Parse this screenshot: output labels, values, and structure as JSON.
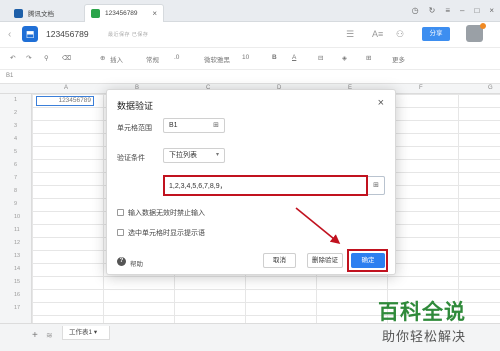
{
  "browser": {
    "tabs": [
      {
        "label": "腾讯文档"
      },
      {
        "label": "123456789"
      }
    ]
  },
  "header": {
    "doc_title": "123456789",
    "save_status": "最近保存 已保存",
    "share_label": "分享"
  },
  "toolbar": {
    "insert": "插入",
    "format_general": "常规",
    "font": "微软雅黑",
    "font_size": "10",
    "bold": "B",
    "font_color": "A",
    "more": "更多"
  },
  "formula_bar": {
    "cell_ref": "B1"
  },
  "sheet": {
    "columns": [
      "A",
      "B",
      "C",
      "D",
      "E",
      "F",
      "G"
    ],
    "rows": [
      "1",
      "2",
      "3",
      "4",
      "5",
      "6",
      "7",
      "8",
      "9",
      "10",
      "11",
      "12",
      "13",
      "14",
      "15",
      "16",
      "17"
    ],
    "cell_a1": "123456789",
    "tab_name": "工作表1"
  },
  "dialog": {
    "title": "数据验证",
    "range_label": "单元格范围",
    "range_value": "B1",
    "criteria_label": "验证条件",
    "criteria_value": "下拉列表",
    "source_value": "1,2,3,4,5,6,7,8,9，",
    "reject_invalid_label": "输入数据无效时禁止输入",
    "show_tip_label": "选中单元格时显示提示语",
    "help_label": "帮助",
    "cancel_label": "取消",
    "delete_label": "删除验证",
    "ok_label": "确定"
  },
  "watermark": {
    "title": "百科全说",
    "subtitle": "助你轻松解决"
  },
  "colors": {
    "accent": "#2d7ff0",
    "highlight": "#c1121f",
    "watermark": "#2f8a3a"
  }
}
